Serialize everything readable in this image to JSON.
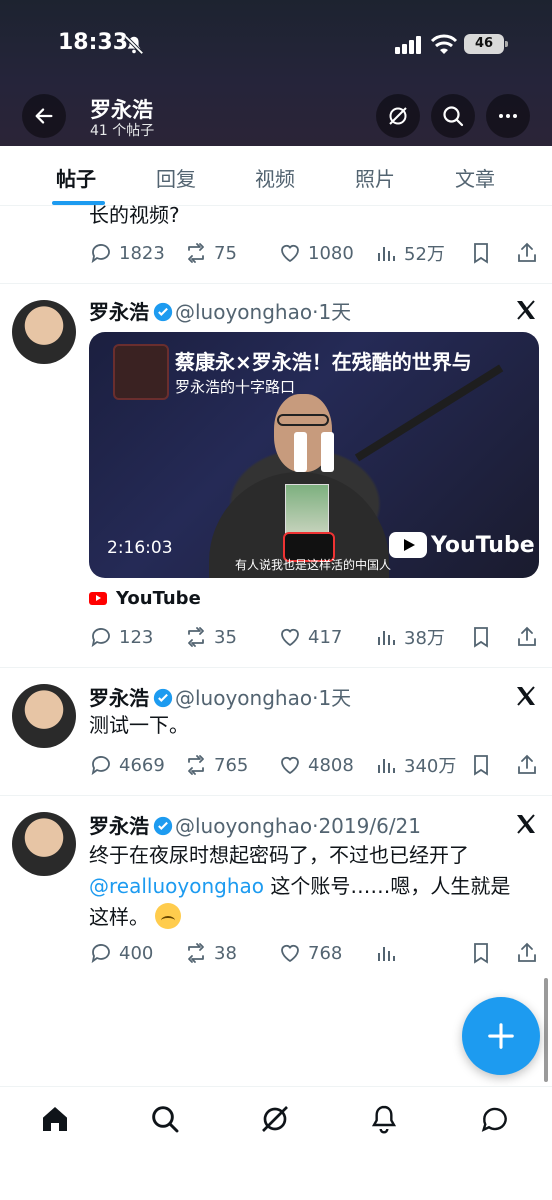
{
  "status_bar": {
    "time": "18:33",
    "battery": "46"
  },
  "header": {
    "profile_name": "罗永浩",
    "post_count": "41 个帖子"
  },
  "tabs": [
    {
      "label": "帖子",
      "active": true
    },
    {
      "label": "回复",
      "active": false
    },
    {
      "label": "视频",
      "active": false
    },
    {
      "label": "照片",
      "active": false
    },
    {
      "label": "文章",
      "active": false
    }
  ],
  "tweets": [
    {
      "text_fragment": "长的视频?",
      "replies": "1823",
      "reposts": "75",
      "likes": "1080",
      "views": "52万"
    },
    {
      "name": "罗永浩",
      "handle": "@luoyonghao",
      "dot": "·",
      "date": "1天",
      "video": {
        "title": "蔡康永×罗永浩！在残酷的世界与",
        "channel": "罗永浩的十字路口",
        "duration": "2:16:03",
        "subtitle": "有人说我也是这样活的中国人",
        "watermark": "YouTube"
      },
      "source": "YouTube",
      "replies": "123",
      "reposts": "35",
      "likes": "417",
      "views": "38万"
    },
    {
      "name": "罗永浩",
      "handle": "@luoyonghao",
      "dot": "·",
      "date": "1天",
      "text": "测试一下。",
      "replies": "4669",
      "reposts": "765",
      "likes": "4808",
      "views": "340万"
    },
    {
      "name": "罗永浩",
      "handle": "@luoyonghao",
      "dot": "·",
      "date": "2019/6/21",
      "text_line1": "终于在夜尿时想起密码了，不过也已经开了",
      "mention": "@realluoyonghao",
      "text_line2_rest": " 这个账号……嗯，人生就是",
      "text_line3": "这样。",
      "replies": "400",
      "reposts": "38",
      "likes": "768"
    }
  ],
  "colors": {
    "accent": "#1d9bf0",
    "text": "#0f1419",
    "muted": "#536471"
  }
}
